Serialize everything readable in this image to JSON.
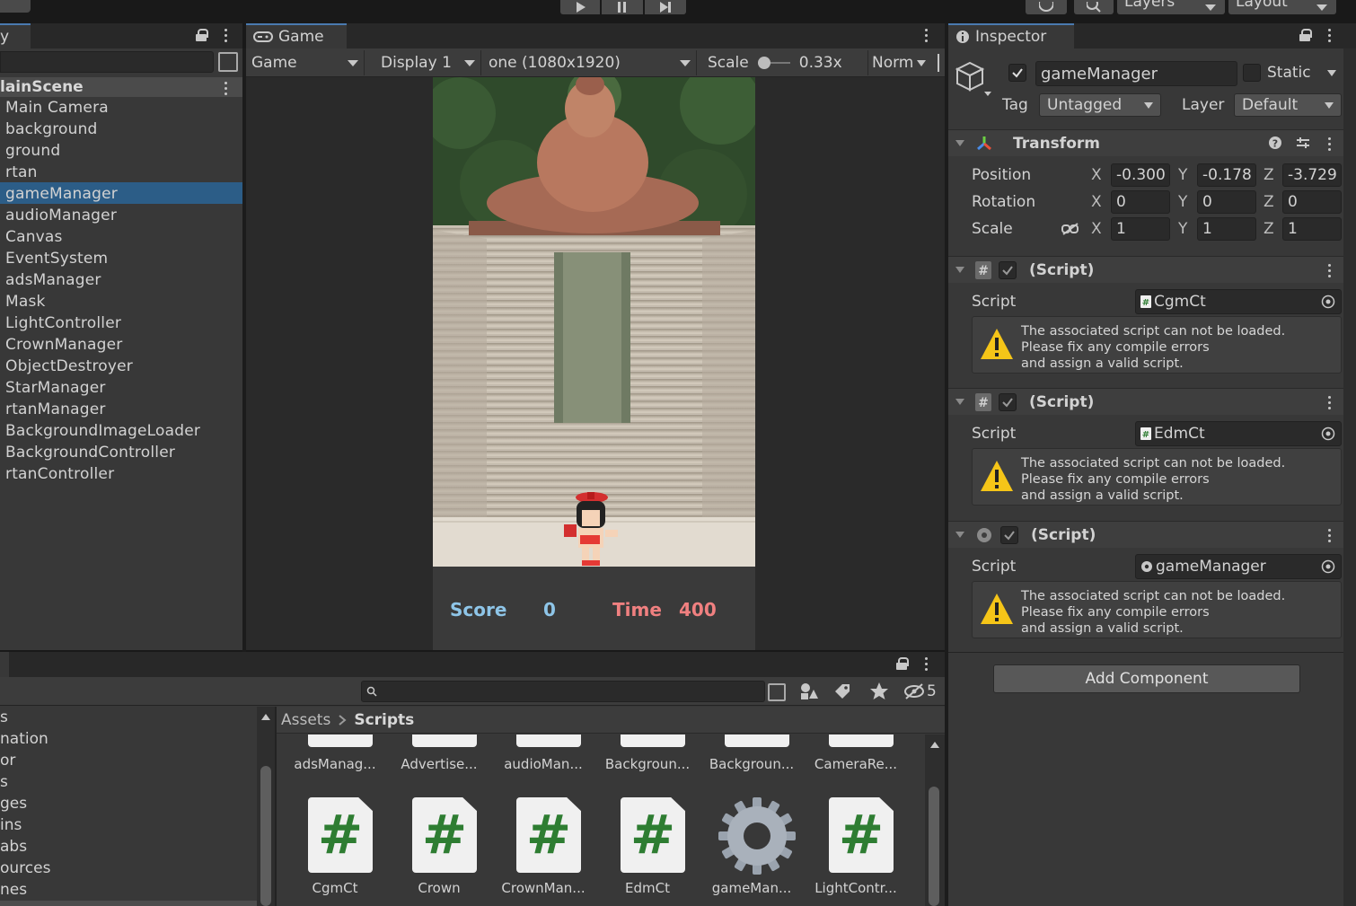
{
  "toolbar": {
    "layers_label": "Layers",
    "layout_label": "Layout"
  },
  "hierarchy": {
    "tab_label": "y",
    "scene_name": "lainScene",
    "items": [
      {
        "label": "Main Camera"
      },
      {
        "label": "background"
      },
      {
        "label": "ground"
      },
      {
        "label": "rtan"
      },
      {
        "label": "gameManager",
        "selected": true
      },
      {
        "label": "audioManager"
      },
      {
        "label": "Canvas"
      },
      {
        "label": "EventSystem"
      },
      {
        "label": "adsManager"
      },
      {
        "label": "Mask"
      },
      {
        "label": "LightController"
      },
      {
        "label": "CrownManager"
      },
      {
        "label": "ObjectDestroyer"
      },
      {
        "label": "StarManager"
      },
      {
        "label": "rtanManager"
      },
      {
        "label": "BackgroundImageLoader"
      },
      {
        "label": "BackgroundController"
      },
      {
        "label": "rtanController"
      }
    ]
  },
  "game": {
    "tab_label": "Game",
    "mode_dropdown": "Game",
    "display_dropdown": "Display 1",
    "resolution_dropdown": "one (1080x1920)",
    "scale_label": "Scale",
    "scale_value": "0.33x",
    "norm_dropdown": "Norm",
    "hud": {
      "score_label": "Score",
      "score_value": "0",
      "time_label": "Time",
      "time_value": "400"
    }
  },
  "inspector": {
    "tab_label": "Inspector",
    "object_name": "gameManager",
    "static_label": "Static",
    "tag_label": "Tag",
    "tag_value": "Untagged",
    "layer_label": "Layer",
    "layer_value": "Default",
    "transform": {
      "title": "Transform",
      "position_label": "Position",
      "rotation_label": "Rotation",
      "scale_label": "Scale",
      "axis_x": "X",
      "axis_y": "Y",
      "axis_z": "Z",
      "position": {
        "x": "-0.300",
        "y": "-0.178",
        "z": "-3.729"
      },
      "rotation": {
        "x": "0",
        "y": "0",
        "z": "0"
      },
      "scale": {
        "x": "1",
        "y": "1",
        "z": "1"
      }
    },
    "components": [
      {
        "title": "(Script)",
        "script_label": "Script",
        "script_value": "CgmCt",
        "warning_l1": "The associated script can not be loaded.",
        "warning_l2": "Please fix any compile errors",
        "warning_l3": "and assign a valid script."
      },
      {
        "title": "(Script)",
        "script_label": "Script",
        "script_value": "EdmCt",
        "warning_l1": "The associated script can not be loaded.",
        "warning_l2": "Please fix any compile errors",
        "warning_l3": "and assign a valid script."
      },
      {
        "title": "(Script)",
        "script_label": "Script",
        "script_value": "gameManager",
        "warning_l1": "The associated script can not be loaded.",
        "warning_l2": "Please fix any compile errors",
        "warning_l3": "and assign a valid script."
      }
    ],
    "add_component_label": "Add Component"
  },
  "project": {
    "hidden_count": "5",
    "breadcrumb_root": "Assets",
    "breadcrumb_current": "Scripts",
    "folders": [
      "s",
      "nation",
      "or",
      "s",
      "ges",
      "ins",
      "abs",
      "ources",
      "nes"
    ],
    "assets_row1": [
      "adsManag...",
      "Advertise...",
      "audioMan...",
      "Backgroun...",
      "Backgroun...",
      "CameraRe..."
    ],
    "assets_row2": [
      "CgmCt",
      "Crown",
      "CrownMan...",
      "EdmCt",
      "gameMan...",
      "LightContr..."
    ]
  },
  "colors": {
    "selection": "#2c5d87",
    "score_blue": "#8ec5e8",
    "time_red": "#f08080",
    "warning_yellow": "#f5c518",
    "script_green": "#2e7d32"
  }
}
